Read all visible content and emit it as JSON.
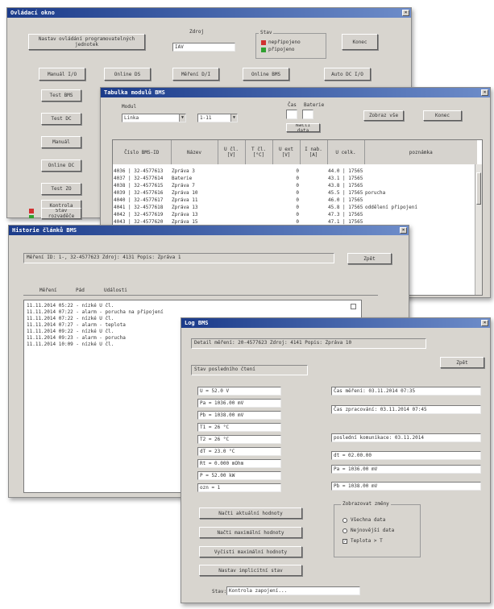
{
  "w1": {
    "title": "Ovládací okno",
    "button_left": "Nastav ovládání programovatelných jednotek",
    "field_label": "Zdroj",
    "field_value": "IAV",
    "legend_label": "Stav",
    "legend_red": "nepřipojeno",
    "legend_green": "připojeno",
    "close_btn": "Konec",
    "row_buttons": [
      "Manuál I/O",
      "Online DS",
      "Měření D/I",
      "Online BMS",
      "Auto DC I/O"
    ],
    "side_buttons": [
      "Test BMS",
      "Test DC",
      "Manuál",
      "Online DC",
      "Test ZO",
      "Kontrola",
      "Stav rozvaděče"
    ]
  },
  "w2": {
    "title": "Tabulka modulů BMS",
    "filter_label": "Modul",
    "filter_value": "Linka",
    "filter2_value": "1-11",
    "num_label1": "Čas",
    "num_label2": "Baterie",
    "refresh_btn": "Načti data",
    "btn_a": "Zobraz vše",
    "btn_b": "Konec",
    "headers": [
      "Číslo BMS-ID",
      "Název",
      "U čl. [V]",
      "T čl. [°C]",
      "U ext [V]",
      "I nab. [A]",
      "U celk.",
      "poznámka"
    ],
    "rows": [
      [
        "4036 | 32-4577613",
        "Zpráva 3",
        "",
        "",
        "0",
        "",
        "44.0 | 17565",
        ""
      ],
      [
        "4037 | 32-4577614",
        "Baterie",
        "",
        "",
        "0",
        "",
        "43.1 | 17565",
        ""
      ],
      [
        "4038 | 32-4577615",
        "Zpráva 7",
        "",
        "",
        "0",
        "",
        "43.8 | 17565",
        ""
      ],
      [
        "4039 | 32-4577616",
        "Zpráva 10",
        "",
        "",
        "0",
        "",
        "45.5 | 17565",
        "porucha"
      ],
      [
        "4040 | 32-4577617",
        "Zpráva 11",
        "",
        "",
        "0",
        "",
        "46.0 | 17565",
        ""
      ],
      [
        "4041 | 32-4577618",
        "Zpráva 13",
        "",
        "",
        "0",
        "",
        "45.8 | 17565",
        "oddělení připojení"
      ],
      [
        "4042 | 32-4577619",
        "Zpráva 13",
        "",
        "",
        "0",
        "",
        "47.3 | 17565",
        ""
      ],
      [
        "4043 | 32-4577620",
        "Zpráva 15",
        "",
        "",
        "0",
        "",
        "47.1 | 17565",
        ""
      ]
    ]
  },
  "w3": {
    "title": "Historie článků BMS",
    "info": "Měření ID: 1-, 32-4577623  Zdroj: 4131  Popis: Zpráva 1",
    "close_btn": "Zpět",
    "tabs": [
      "Měření",
      "Pád",
      "Události"
    ],
    "log": [
      "11.11.2014 05:22 - nízké U čl.",
      "11.11.2014 07:22 - alarm - porucha na připojení",
      "11.11.2014 07:22 - nízké U čl.",
      "11.11.2014 07:27 - alarm - teplota",
      "11.11.2014 09:22 - nízké U čl.",
      "11.11.2014 09:23 - alarm - porucha",
      "11.11.2014 10:09 - nízké U čl."
    ]
  },
  "w4": {
    "title": "Log BMS",
    "header_info": "Detail měření: 20-4577623  Zdroj: 4141  Popis: Zpráva 10",
    "close_btn": "Zpět",
    "status": "Stav posledního čtení",
    "left_values": [
      "U = 52.0 V",
      "Pa = 1036.00 mV",
      "Pb = 1038.00 mV",
      "T1 = 26 °C",
      "T2 = 26 °C",
      "dT = 23.0 °C",
      "Rt = 0.000 mOhm",
      "P = 52.00 kW",
      "ozn = 1"
    ],
    "right_values": [
      "Čas měření: 03.11.2014 07:35",
      "Čas zpracování: 03.11.2014 07:45",
      "",
      "poslední komunikace: 03.11.2014",
      "dt = 02.00.00",
      "Pa = 1036.00 mV",
      "Pb = 1038.00 mV"
    ],
    "action_buttons": [
      "Načti aktuální hodnoty",
      "Načti maximální hodnoty",
      "Vyčisti maximální hodnoty",
      "Nastav implicitní stav"
    ],
    "group_title": "Zobrazovat změny",
    "radios": [
      "Všechna data",
      "Nejnovější data"
    ],
    "checkbox": "Teplota > T",
    "bottom_label": "Stav:",
    "bottom_value": "Kontrola zapojení..."
  }
}
